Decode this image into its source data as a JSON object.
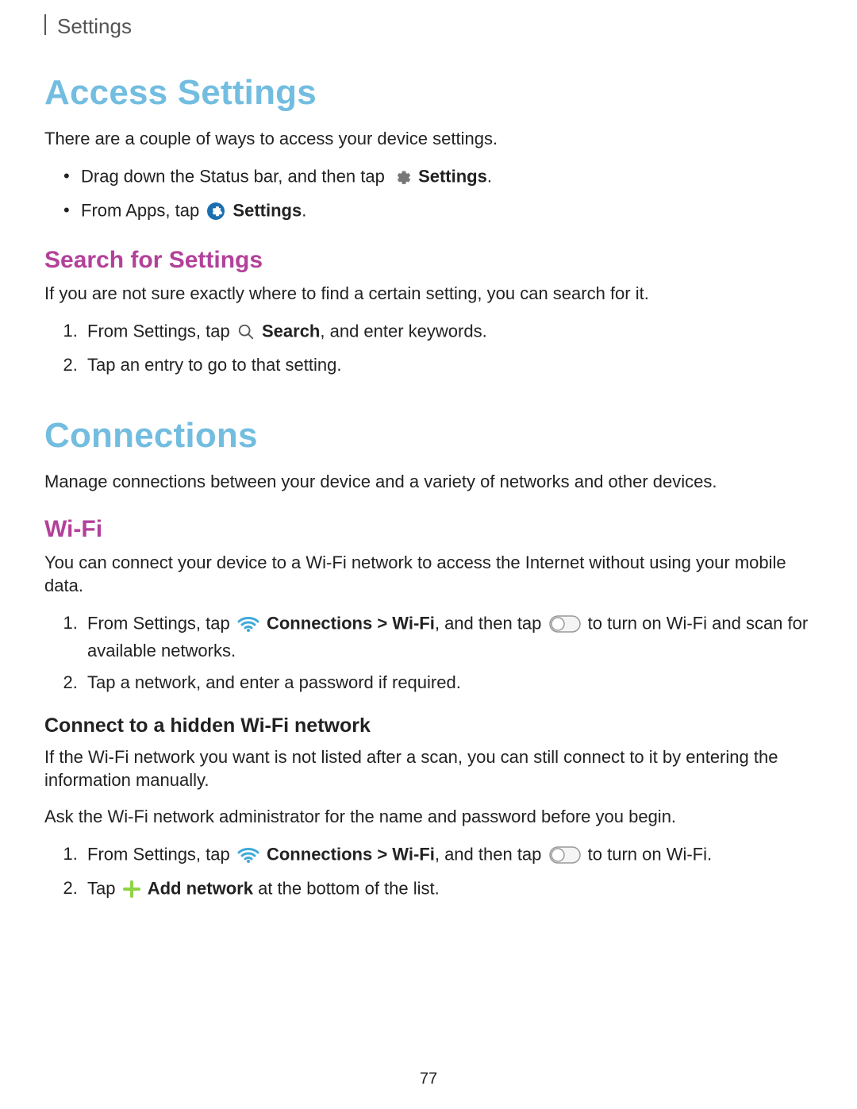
{
  "header": {
    "section": "Settings"
  },
  "s1": {
    "title": "Access Settings",
    "intro": "There are a couple of ways to access your device settings.",
    "bullet1_a": "Drag down the Status bar, and then tap ",
    "bullet1_b": "Settings",
    "bullet1_c": ".",
    "bullet2_a": "From Apps, tap ",
    "bullet2_b": "Settings",
    "bullet2_c": "."
  },
  "s2": {
    "title": "Search for Settings",
    "intro": "If you are not sure exactly where to find a certain setting, you can search for it.",
    "step1_a": "From Settings, tap ",
    "step1_b": "Search",
    "step1_c": ", and enter keywords.",
    "step2": "Tap an entry to go to that setting."
  },
  "s3": {
    "title": "Connections",
    "intro": "Manage connections between your device and a variety of networks and other devices."
  },
  "s4": {
    "title": "Wi-Fi",
    "intro": "You can connect your device to a Wi-Fi network to access the Internet without using your mobile data.",
    "step1_a": "From Settings, tap ",
    "step1_b": "Connections > Wi-Fi",
    "step1_c": ", and then tap ",
    "step1_d": " to turn on Wi-Fi and scan for available networks.",
    "step2": "Tap a network, and enter a password if required."
  },
  "s5": {
    "title": "Connect to a hidden Wi-Fi network",
    "p1": "If the Wi-Fi network you want is not listed after a scan, you can still connect to it by entering the information manually.",
    "p2": "Ask the Wi-Fi network administrator for the name and password before you begin.",
    "step1_a": "From Settings, tap ",
    "step1_b": "Connections > Wi-Fi",
    "step1_c": ", and then tap ",
    "step1_d": " to turn on Wi-Fi.",
    "step2_a": "Tap ",
    "step2_b": "Add network",
    "step2_c": " at the bottom of the list."
  },
  "page_number": "77",
  "colors": {
    "accent_blue": "#72bde0",
    "accent_magenta": "#b3419a",
    "wifi_blue": "#3fa9d8",
    "plus_green": "#8fd444"
  }
}
